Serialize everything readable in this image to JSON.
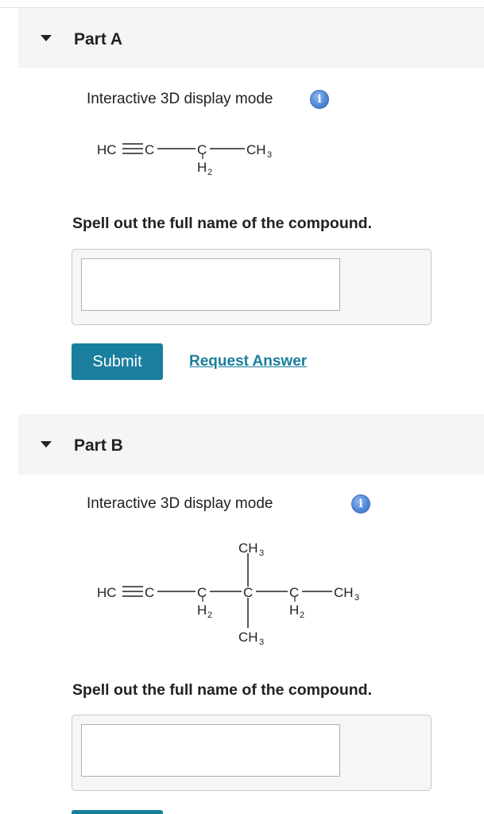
{
  "part_a": {
    "title": "Part A",
    "display_mode_label": "Interactive 3D display mode",
    "structure": {
      "hc": "HC",
      "c1": "C",
      "c2": "C",
      "h2": "H",
      "h2_sub": "2",
      "ch": "CH",
      "ch_sub": "3"
    },
    "prompt": "Spell out the full name of the compound.",
    "answer_value": "",
    "submit_label": "Submit",
    "request_answer_label": "Request Answer"
  },
  "part_b": {
    "title": "Part B",
    "display_mode_label": "Interactive 3D display mode",
    "structure": {
      "hc": "HC",
      "c1": "C",
      "c2": "C",
      "c3": "C",
      "c4": "C",
      "h": "H",
      "h_sub": "2",
      "ch": "CH",
      "ch_sub": "3"
    },
    "prompt": "Spell out the full name of the compound.",
    "answer_value": ""
  },
  "icons": {
    "caret": "caret-down-icon",
    "info": "info-icon",
    "info_glyph": "i"
  },
  "colors": {
    "accent": "#1a7f9e",
    "header_bg": "#f5f5f5",
    "info_blue": "#4c86d8"
  }
}
